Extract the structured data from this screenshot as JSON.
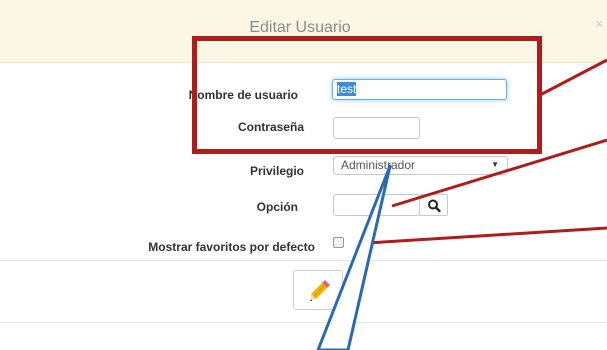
{
  "modal": {
    "title": "Editar Usuario",
    "close_label": "×"
  },
  "form": {
    "username_label": "Nombre de usuario",
    "username_value": "test",
    "password_label": "Contraseña",
    "password_value": "",
    "privilege_label": "Privilegio",
    "privilege_selected": "Administrador",
    "option_label": "Opción",
    "option_value": "",
    "favorites_label": "Mostrar favoritos por defecto",
    "favorites_checked": false
  },
  "icons": {
    "search": "search-icon",
    "edit": "pencil-icon",
    "dropdown": "chevron-down-icon"
  },
  "colors": {
    "header_bg": "#fcf7e4",
    "highlight_red": "#b01c1c",
    "callout_blue": "#2a6ab0",
    "focus_blue": "#66afe9"
  }
}
